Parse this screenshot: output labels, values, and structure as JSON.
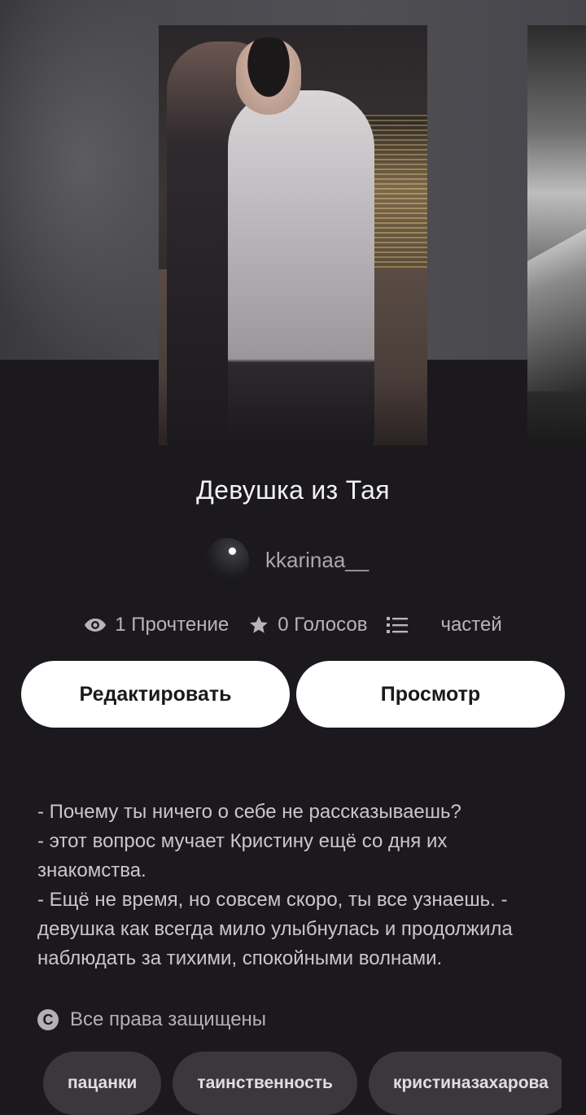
{
  "story": {
    "title": "Девушка из Тая",
    "author": "kkarinaa__"
  },
  "stats": {
    "reads": "1 Прочтение",
    "votes": "0 Голосов",
    "parts": "частей"
  },
  "actions": {
    "edit_label": "Редактировать",
    "view_label": "Просмотр"
  },
  "description": [
    "- Почему ты ничего о себе не рассказываешь?",
    "- этот вопрос мучает Кристину ещё со дня их знакомства.",
    "- Ещё не время, но совсем скоро, ты все узнаешь. - девушка как всегда мило улыбнулась и продолжила наблюдать за тихими, спокойными волнами."
  ],
  "copyright": {
    "icon_label": "C",
    "text": "Все права защищены"
  },
  "tags": [
    "пацанки",
    "таинственность",
    "кристиназахарова"
  ],
  "icons": {
    "reads": "eye-icon",
    "votes": "star-icon",
    "parts": "list-icon",
    "copyright": "copyright-icon"
  },
  "colors": {
    "background": "#1b191e",
    "button": "#ffffff",
    "tag": "#3a383d"
  }
}
